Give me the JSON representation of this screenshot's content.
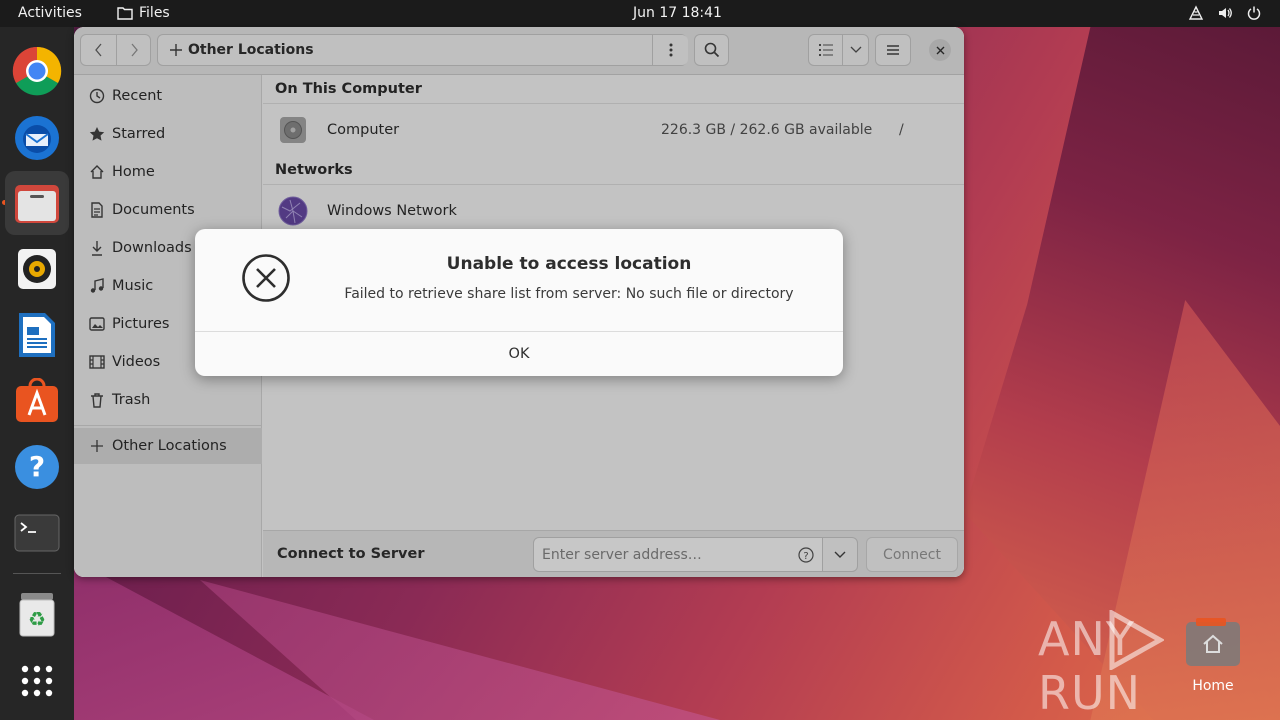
{
  "topbar": {
    "activities": "Activities",
    "app_name": "Files",
    "clock": "Jun 17  18:41"
  },
  "window": {
    "path_label": "Other Locations",
    "sidebar": {
      "items": [
        {
          "label": "Recent",
          "icon": "clock-icon"
        },
        {
          "label": "Starred",
          "icon": "star-icon"
        },
        {
          "label": "Home",
          "icon": "home-icon"
        },
        {
          "label": "Documents",
          "icon": "document-icon"
        },
        {
          "label": "Downloads",
          "icon": "download-icon"
        },
        {
          "label": "Music",
          "icon": "music-icon"
        },
        {
          "label": "Pictures",
          "icon": "picture-icon"
        },
        {
          "label": "Videos",
          "icon": "video-icon"
        },
        {
          "label": "Trash",
          "icon": "trash-icon"
        }
      ],
      "other_locations": "Other Locations"
    },
    "on_this_computer": "On This Computer",
    "computer": {
      "name": "Computer",
      "space": "226.3 GB / 262.6 GB available",
      "mount": "/"
    },
    "networks": "Networks",
    "windows_network": "Windows Network",
    "connect_to_server": "Connect to Server",
    "server_placeholder": "Enter server address…",
    "connect_label": "Connect"
  },
  "dialog": {
    "title": "Unable to access location",
    "message": "Failed to retrieve share list from server: No such file or directory",
    "ok": "OK"
  },
  "desktop": {
    "home_label": "Home",
    "watermark": "ANY RUN"
  },
  "colors": {
    "accent": "#e95420",
    "topbar": "#1b1b1b",
    "dock": "#262626"
  }
}
